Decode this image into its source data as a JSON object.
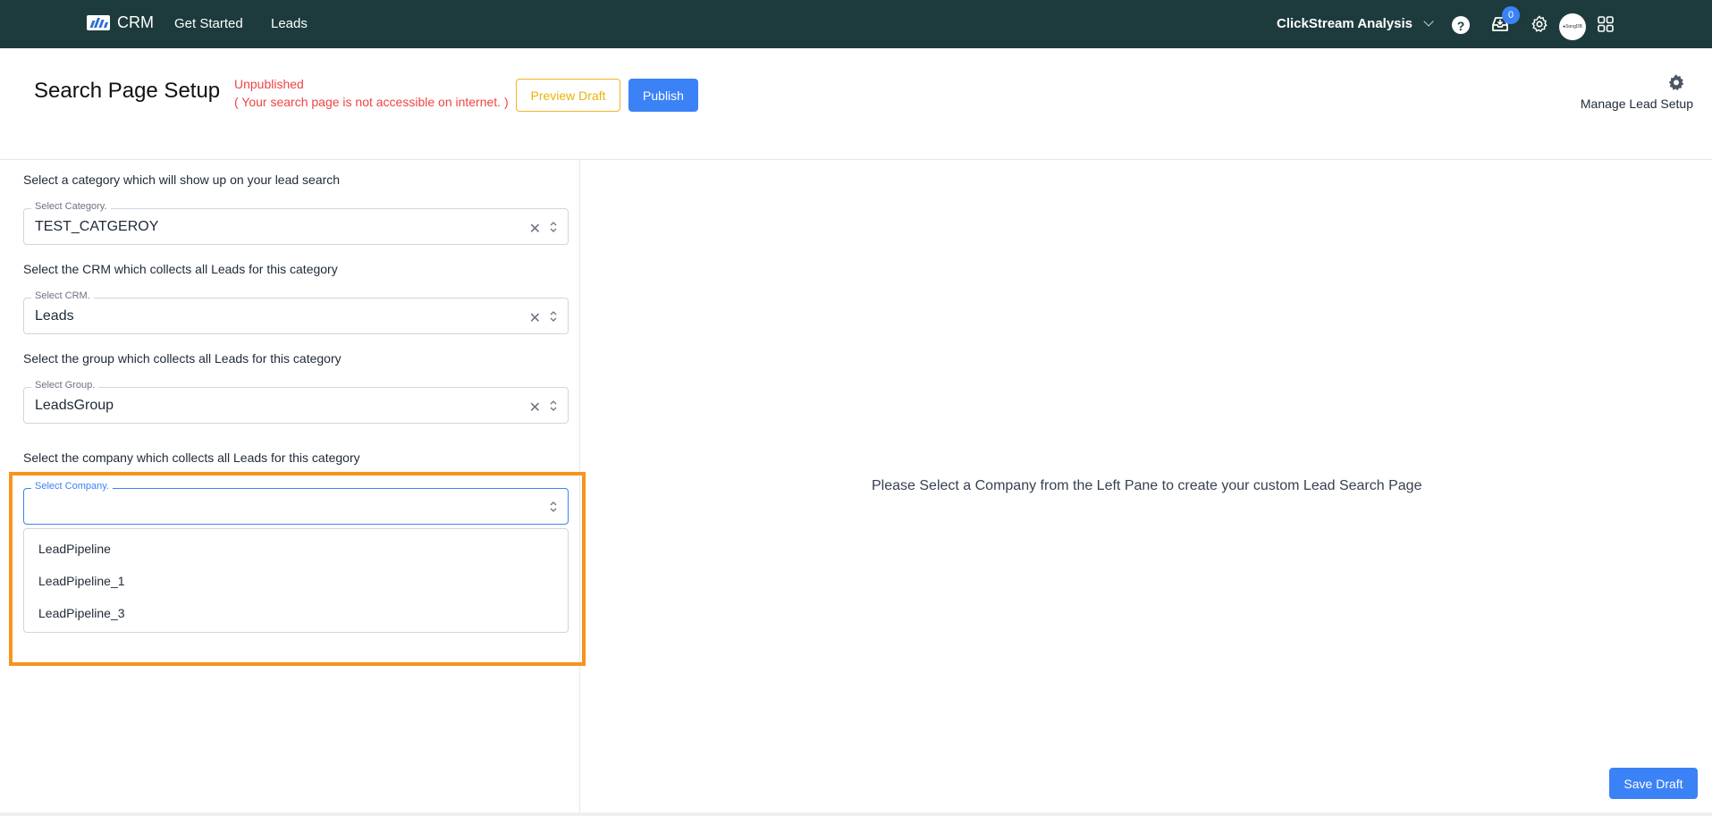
{
  "topbar": {
    "brand": "CRM",
    "nav": [
      "Get Started",
      "Leads"
    ],
    "app_switcher": "ClickStream Analysis",
    "help_glyph": "?",
    "notification_count": "0",
    "avatar_text": "●SongDB",
    "colors": {
      "background": "#1d3b3c",
      "badge": "#3b82f6"
    }
  },
  "header": {
    "title": "Search Page Setup",
    "status": "Unpublished",
    "status_note": "( Your search page is not accessible on internet. )",
    "preview_label": "Preview Draft",
    "publish_label": "Publish",
    "manage_label": "Manage Lead Setup"
  },
  "form": {
    "category": {
      "prompt": "Select a category which will show up on your lead search",
      "legend": "Select Category.",
      "value": "TEST_CATGEROY"
    },
    "crm": {
      "prompt": "Select the CRM which collects all Leads for this category",
      "legend": "Select CRM.",
      "value": "Leads"
    },
    "group": {
      "prompt": "Select the group which collects all Leads for this category",
      "legend": "Select Group.",
      "value": "LeadsGroup"
    },
    "company": {
      "prompt": "Select the company which collects all Leads for this category",
      "legend": "Select Company.",
      "value": "",
      "options": [
        "LeadPipeline",
        "LeadPipeline_1",
        "LeadPipeline_3"
      ]
    }
  },
  "main": {
    "empty_message": "Please Select a Company from the Left Pane to create your custom Lead Search Page",
    "save_label": "Save Draft"
  },
  "accent_color": "#f7931e"
}
